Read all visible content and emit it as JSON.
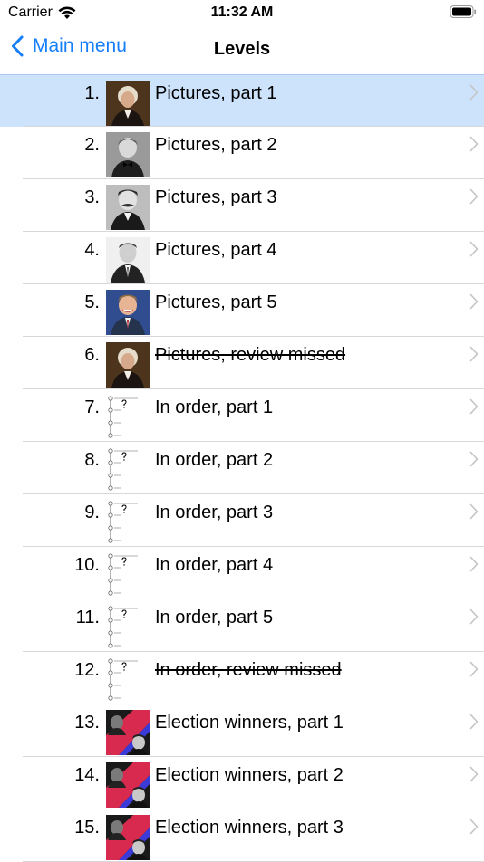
{
  "status": {
    "carrier": "Carrier",
    "time": "11:32 AM"
  },
  "nav": {
    "back_label": "Main menu",
    "title": "Levels"
  },
  "colors": {
    "accent": "#147efb",
    "selected_row": "#cde3fb",
    "separator": "#d8d8dc",
    "chevron": "#c4c4c7"
  },
  "levels": [
    {
      "number": "1.",
      "label": "Pictures, part 1",
      "thumbnail": "portrait-washington",
      "struck": false,
      "selected": true
    },
    {
      "number": "2.",
      "label": "Pictures, part 2",
      "thumbnail": "portrait-bw-bowtie",
      "struck": false,
      "selected": false
    },
    {
      "number": "3.",
      "label": "Pictures, part 3",
      "thumbnail": "portrait-bw-mustache",
      "struck": false,
      "selected": false
    },
    {
      "number": "4.",
      "label": "Pictures, part 4",
      "thumbnail": "portrait-bw-suit",
      "struck": false,
      "selected": false
    },
    {
      "number": "5.",
      "label": "Pictures, part 5",
      "thumbnail": "portrait-color-smile",
      "struck": false,
      "selected": false
    },
    {
      "number": "6.",
      "label": "Pictures, review missed",
      "thumbnail": "portrait-washington",
      "struck": true,
      "selected": false
    },
    {
      "number": "7.",
      "label": "In order, part 1",
      "thumbnail": "timeline-icon",
      "struck": false,
      "selected": false
    },
    {
      "number": "8.",
      "label": "In order, part 2",
      "thumbnail": "timeline-icon",
      "struck": false,
      "selected": false
    },
    {
      "number": "9.",
      "label": "In order, part 3",
      "thumbnail": "timeline-icon",
      "struck": false,
      "selected": false
    },
    {
      "number": "10.",
      "label": "In order, part 4",
      "thumbnail": "timeline-icon",
      "struck": false,
      "selected": false
    },
    {
      "number": "11.",
      "label": "In order, part 5",
      "thumbnail": "timeline-icon",
      "struck": false,
      "selected": false
    },
    {
      "number": "12.",
      "label": "In order, review missed",
      "thumbnail": "timeline-icon",
      "struck": true,
      "selected": false
    },
    {
      "number": "13.",
      "label": "Election winners, part 1",
      "thumbnail": "election-collage",
      "struck": false,
      "selected": false
    },
    {
      "number": "14.",
      "label": "Election winners, part 2",
      "thumbnail": "election-collage",
      "struck": false,
      "selected": false
    },
    {
      "number": "15.",
      "label": "Election winners, part 3",
      "thumbnail": "election-collage",
      "struck": false,
      "selected": false
    }
  ]
}
